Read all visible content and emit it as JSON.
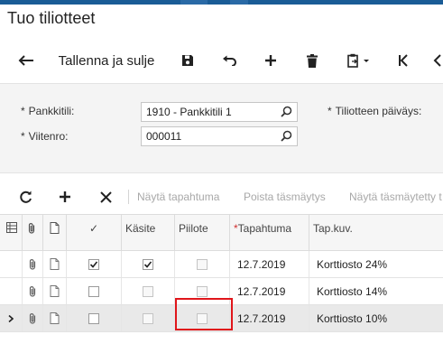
{
  "page": {
    "title": "Tuo tiliotteet"
  },
  "toolbar": {
    "back_icon": "back-arrow-icon",
    "save_close_label": "Tallenna ja sulje",
    "save_icon": "save-icon",
    "undo_icon": "undo-icon",
    "add_icon": "plus-icon",
    "delete_icon": "trash-icon",
    "clipboard_icon": "clipboard-icon",
    "first_icon": "first-record-icon",
    "prev_icon": "previous-record-icon"
  },
  "form": {
    "bank_account_label": "Pankkitili:",
    "bank_account_value": "1910 - Pankkitili 1",
    "reference_label": "Viitenro:",
    "reference_value": "000011",
    "statement_date_label": "Tiliotteen päiväys:",
    "required_mark": "*"
  },
  "grid_toolbar": {
    "refresh_icon": "refresh-icon",
    "add_icon": "plus-icon",
    "remove_icon": "close-icon",
    "show_transaction": "Näytä tapahtuma",
    "unmatch": "Poista täsmäytys",
    "show_matched": "Näytä täsmäytetty t"
  },
  "grid": {
    "columns": {
      "checkmark": "✓",
      "processed": "Käsite",
      "hidden": "Piilote",
      "tran_date": "Tapahtuma",
      "tran_desc": "Tap.kuv."
    },
    "rows": [
      {
        "selected": false,
        "checked": true,
        "processed": true,
        "hidden": false,
        "date": "12.7.2019",
        "desc": "Korttiosto 24%"
      },
      {
        "selected": false,
        "checked": false,
        "processed": false,
        "hidden": false,
        "date": "12.7.2019",
        "desc": "Korttiosto 14%"
      },
      {
        "selected": true,
        "checked": false,
        "processed": false,
        "hidden": false,
        "date": "12.7.2019",
        "desc": "Korttiosto 10%"
      }
    ]
  },
  "colors": {
    "accent": "#1a5c96",
    "highlight": "#e0161b",
    "required": "#d03030"
  }
}
